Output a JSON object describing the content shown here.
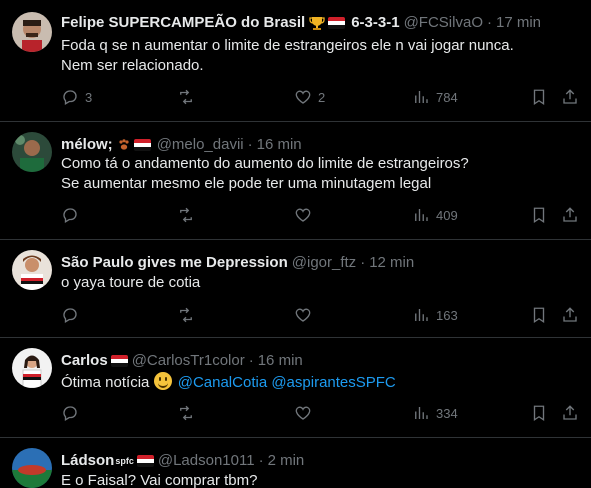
{
  "colors": {
    "background": "#000000",
    "text": "#e7e9ea",
    "muted": "#71767b",
    "link": "#1d9bf0",
    "divider": "#2f3336"
  },
  "tweets": [
    {
      "name": "Felipe SUPERCAMPEÃO do Brasil",
      "name_suffix": "6-3-3-1",
      "handle": "@FCSilvaO",
      "time": "17 min",
      "lines": [
        "Foda q se n aumentar o limite de estrangeiros ele n vai jogar nunca.",
        "Nem ser relacionado."
      ],
      "replies": "3",
      "retweets": "",
      "likes": "2",
      "views": "784"
    },
    {
      "name": "mélow;",
      "handle": "@melo_davii",
      "time": "16 min",
      "lines": [
        "Como tá o andamento do aumento do limite de estrangeiros?",
        "Se aumentar mesmo ele pode ter uma minutagem legal"
      ],
      "replies": "",
      "retweets": "",
      "likes": "",
      "views": "409"
    },
    {
      "name": "São Paulo gives me Depression",
      "handle": "@igor_ftz",
      "time": "12 min",
      "lines": [
        "o yaya toure de cotia"
      ],
      "replies": "",
      "retweets": "",
      "likes": "",
      "views": "163"
    },
    {
      "name": "Carlos",
      "handle": "@CarlosTr1color",
      "time": "16 min",
      "text_prefix": "Ótima notícia",
      "mentions": [
        "@CanalCotia",
        "@aspirantesSPFC"
      ],
      "replies": "",
      "retweets": "",
      "likes": "",
      "views": "334"
    },
    {
      "name": "Ládson",
      "name_badge": "spfc",
      "handle": "@Ladson1011",
      "time": "2 min",
      "lines": [
        "E o Faisal? Vai comprar tbm?"
      ]
    }
  ]
}
